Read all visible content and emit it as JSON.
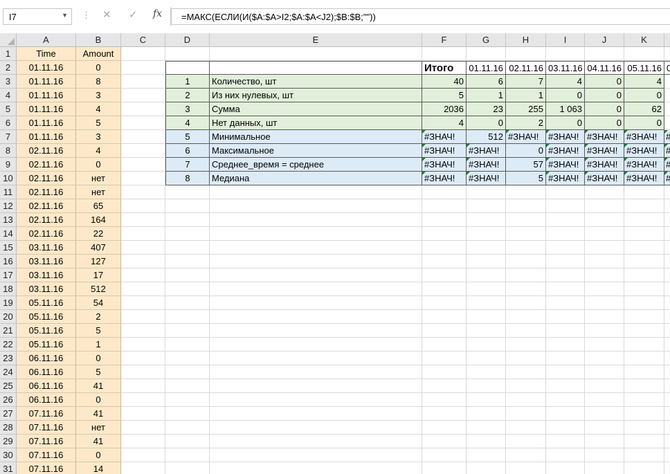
{
  "namebox": {
    "value": "I7"
  },
  "formula": {
    "text": "=МАКС(ЕСЛИ(И($A:$A>I2;$A:$A<J2);$B:$B;\"\"))"
  },
  "icons": {
    "cancel": "✕",
    "enter": "✓",
    "fx": "fx",
    "dropdown": "▼",
    "separator": "⋮"
  },
  "colors": {
    "tan": "#fde9c9",
    "green": "#e2efda",
    "blue": "#ddebf7",
    "error_marker": "#1e7b34"
  },
  "columns": [
    {
      "id": "A",
      "label": "A"
    },
    {
      "id": "B",
      "label": "B"
    },
    {
      "id": "C",
      "label": "C"
    },
    {
      "id": "D",
      "label": "D"
    },
    {
      "id": "E",
      "label": "E"
    },
    {
      "id": "F",
      "label": "F"
    },
    {
      "id": "G",
      "label": "G"
    },
    {
      "id": "H",
      "label": "H"
    },
    {
      "id": "I",
      "label": "I"
    },
    {
      "id": "J",
      "label": "J"
    },
    {
      "id": "K",
      "label": "K"
    },
    {
      "id": "L",
      "label": "L"
    }
  ],
  "rows": [
    "1",
    "2",
    "3",
    "4",
    "5",
    "6",
    "7",
    "8",
    "9",
    "10",
    "11",
    "12",
    "13",
    "14",
    "15",
    "16",
    "17",
    "18",
    "19",
    "20",
    "21",
    "22",
    "23",
    "24",
    "25",
    "26",
    "27",
    "28",
    "29",
    "30",
    "31"
  ],
  "ab_headers": [
    "Time",
    "Amount"
  ],
  "ab_data": [
    [
      "01.11.16",
      "0"
    ],
    [
      "01.11.16",
      "8"
    ],
    [
      "01.11.16",
      "3"
    ],
    [
      "01.11.16",
      "4"
    ],
    [
      "01.11.16",
      "5"
    ],
    [
      "01.11.16",
      "3"
    ],
    [
      "02.11.16",
      "4"
    ],
    [
      "02.11.16",
      "0"
    ],
    [
      "02.11.16",
      "нет"
    ],
    [
      "02.11.16",
      "нет"
    ],
    [
      "02.11.16",
      "65"
    ],
    [
      "02.11.16",
      "164"
    ],
    [
      "02.11.16",
      "22"
    ],
    [
      "03.11.16",
      "407"
    ],
    [
      "03.11.16",
      "127"
    ],
    [
      "03.11.16",
      "17"
    ],
    [
      "03.11.16",
      "512"
    ],
    [
      "05.11.16",
      "54"
    ],
    [
      "05.11.16",
      "2"
    ],
    [
      "05.11.16",
      "5"
    ],
    [
      "05.11.16",
      "1"
    ],
    [
      "06.11.16",
      "0"
    ],
    [
      "06.11.16",
      "5"
    ],
    [
      "06.11.16",
      "41"
    ],
    [
      "06.11.16",
      "0"
    ],
    [
      "07.11.16",
      "41"
    ],
    [
      "07.11.16",
      "нет"
    ],
    [
      "07.11.16",
      "41"
    ],
    [
      "07.11.16",
      "0"
    ],
    [
      "07.11.16",
      "14"
    ]
  ],
  "summary": {
    "total_label": "Итого",
    "dates": [
      "01.11.16",
      "02.11.16",
      "03.11.16",
      "04.11.16",
      "05.11.16",
      "0"
    ],
    "rows": [
      {
        "n": "1",
        "label": "Количество, шт",
        "total": "40",
        "vals": [
          "6",
          "7",
          "4",
          "0",
          "4"
        ]
      },
      {
        "n": "2",
        "label": "Из них нулевых, шт",
        "total": "5",
        "vals": [
          "1",
          "1",
          "0",
          "0",
          "0"
        ]
      },
      {
        "n": "3",
        "label": "Сумма",
        "total": "2036",
        "vals": [
          "23",
          "255",
          "1 063",
          "0",
          "62"
        ]
      },
      {
        "n": "4",
        "label": "Нет данных, шт",
        "total": "4",
        "vals": [
          "0",
          "2",
          "0",
          "0",
          "0"
        ]
      },
      {
        "n": "5",
        "label": "Минимальное",
        "total": "#ЗНАЧ!",
        "vals": [
          "512",
          "#ЗНАЧ!",
          "#ЗНАЧ!",
          "#ЗНАЧ!",
          "#ЗНАЧ!",
          "#"
        ]
      },
      {
        "n": "6",
        "label": "Максимальное",
        "total": "#ЗНАЧ!",
        "vals": [
          "#ЗНАЧ!",
          "0",
          "#ЗНАЧ!",
          "#ЗНАЧ!",
          "#ЗНАЧ!",
          "#"
        ]
      },
      {
        "n": "7",
        "label": "Среднее_время = среднее",
        "total": "#ЗНАЧ!",
        "vals": [
          "#ЗНАЧ!",
          "57",
          "#ЗНАЧ!",
          "#ЗНАЧ!",
          "#ЗНАЧ!",
          "#"
        ]
      },
      {
        "n": "8",
        "label": "Медиана",
        "total": "#ЗНАЧ!",
        "vals": [
          "#ЗНАЧ!",
          "5",
          "#ЗНАЧ!",
          "#ЗНАЧ!",
          "#ЗНАЧ!",
          "#"
        ]
      }
    ]
  }
}
